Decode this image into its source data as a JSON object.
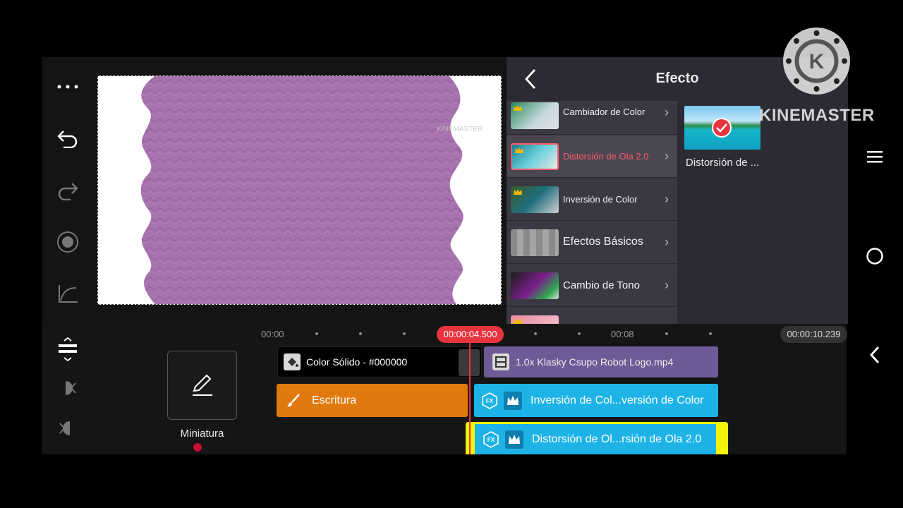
{
  "panel": {
    "title": "Efecto",
    "items": [
      {
        "label": "Cambiador de Color",
        "active": false
      },
      {
        "label": "Distorsión de Ola 2.0",
        "active": true
      },
      {
        "label": "Inversión de Color",
        "active": false
      },
      {
        "label": "Efectos Básicos",
        "active": false
      },
      {
        "label": "Cambio de Tono",
        "active": false
      }
    ],
    "selected_label": "Distorsión de ..."
  },
  "watermark": {
    "brand": "KINEMASTER"
  },
  "timeline": {
    "ruler": [
      "00:00",
      "00:08"
    ],
    "current_time": "00:00:04.500",
    "end_time": "00:00:10.239",
    "clips": {
      "solid": "Color Sólido - #000000",
      "video": "1.0x Klasky Csupo Robot Logo.mp4",
      "handwriting": "Escritura",
      "fx1": "Inversión de Col...versión de Color",
      "fx2": "Distorsión de Ol...rsión de Ola 2.0"
    }
  },
  "thumbnail": {
    "label": "Miniatura"
  },
  "colors": {
    "accent": "#e8343f",
    "fx_clip": "#1eb3e6",
    "handwriting_clip": "#e07a0e",
    "video_clip": "#6e5a97",
    "preview_wave": "#a772ae"
  }
}
